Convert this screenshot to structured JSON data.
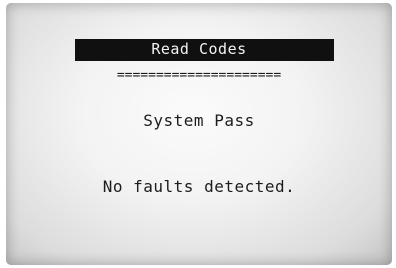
{
  "screen": {
    "title": "Read Codes",
    "separator": "=====================",
    "status": "System Pass",
    "message": "No faults detected."
  },
  "colors": {
    "header_background": "#101010",
    "header_text": "#f2f2f2",
    "text": "#1c1c1c",
    "screen_background": "#f3f3f3"
  }
}
